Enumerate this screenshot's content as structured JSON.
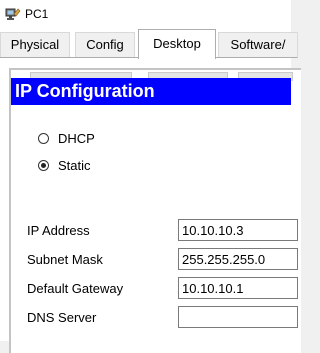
{
  "window": {
    "title": "PC1",
    "icon": "pc-icon"
  },
  "tabs": [
    {
      "label": "Physical",
      "active": false
    },
    {
      "label": "Config",
      "active": false
    },
    {
      "label": "Desktop",
      "active": true
    },
    {
      "label": "Software/",
      "active": false
    }
  ],
  "panel": {
    "title": "IP Configuration"
  },
  "mode": {
    "options": [
      {
        "label": "DHCP",
        "selected": false
      },
      {
        "label": "Static",
        "selected": true
      }
    ]
  },
  "fields": {
    "ip_address": {
      "label": "IP Address",
      "value": "10.10.10.3"
    },
    "subnet_mask": {
      "label": "Subnet Mask",
      "value": "255.255.255.0"
    },
    "default_gateway": {
      "label": "Default Gateway",
      "value": "10.10.10.1"
    },
    "dns_server": {
      "label": "DNS Server",
      "value": ""
    }
  },
  "colors": {
    "header_bg": "#0000ff",
    "header_text": "#ffffff"
  }
}
